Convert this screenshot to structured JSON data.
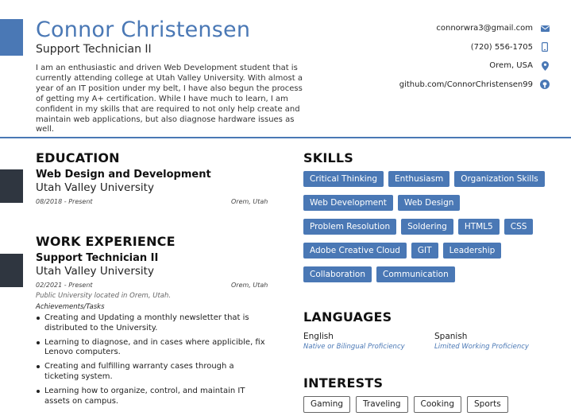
{
  "header": {
    "name": "Connor Christensen",
    "title": "Support Technician II",
    "summary": "I am an enthusiastic and driven Web Development student that is currently attending college at Utah Valley University. With almost a year of an IT position under my belt, I have also begun the process of getting my A+ certification. While I have much to learn, I am confident in my skills that are required to not only help create and maintain web applications, but also diagnose hardware issues as well."
  },
  "contact": [
    {
      "text": "connorwra3@gmail.com",
      "icon": "email-icon"
    },
    {
      "text": "(720) 556-1705",
      "icon": "phone-icon"
    },
    {
      "text": "Orem, USA",
      "icon": "location-icon"
    },
    {
      "text": "github.com/ConnorChristensen99",
      "icon": "github-icon"
    }
  ],
  "education": {
    "heading": "EDUCATION",
    "degree": "Web Design and Development",
    "school": "Utah Valley University",
    "dates": "08/2018 - Present",
    "location": "Orem, Utah"
  },
  "work": {
    "heading": "WORK EXPERIENCE",
    "position": "Support Technician II",
    "company": "Utah Valley University",
    "dates": "02/2021 - Present",
    "location": "Orem, Utah",
    "note": "Public University located in Orem, Utah.",
    "tasks_label": "Achievements/Tasks",
    "tasks": [
      "Creating and Updating a monthly newsletter that is distributed to the University.",
      "Learning to diagnose, and in cases where applicible, fix Lenovo computers.",
      "Creating and fulfilling warranty cases through a ticketing system.",
      "Learning how to organize, control, and maintain IT assets on campus."
    ]
  },
  "skills": {
    "heading": "SKILLS",
    "items": [
      "Critical Thinking",
      "Enthusiasm",
      "Organization Skills",
      "Web Development",
      "Web Design",
      "Problem Resolution",
      "Soldering",
      "HTML5",
      "CSS",
      "Adobe Creative Cloud",
      "GIT",
      "Leadership",
      "Collaboration",
      "Communication"
    ]
  },
  "languages": {
    "heading": "LANGUAGES",
    "items": [
      {
        "name": "English",
        "level": "Native or Bilingual Proficiency"
      },
      {
        "name": "Spanish",
        "level": "Limited Working Proficiency"
      }
    ]
  },
  "interests": {
    "heading": "INTERESTS",
    "items": [
      "Gaming",
      "Traveling",
      "Cooking",
      "Sports"
    ]
  },
  "colors": {
    "accent": "#4a78b5",
    "dark_block": "#2f3640"
  }
}
